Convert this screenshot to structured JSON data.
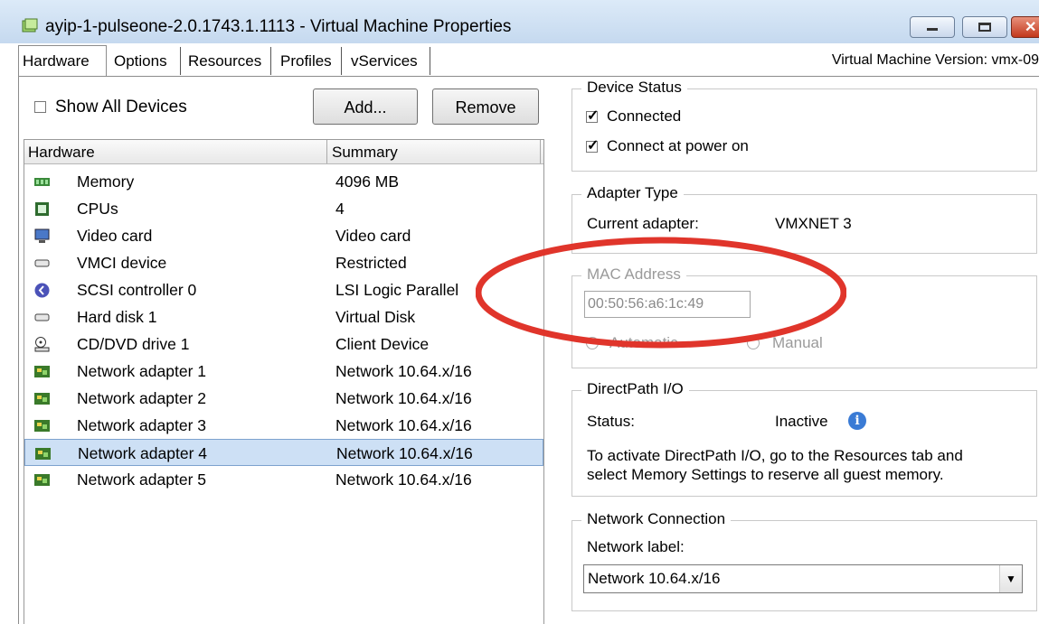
{
  "window": {
    "title": "ayip-1-pulseone-2.0.1743.1.1113 - Virtual Machine Properties",
    "controls": {
      "minimize": "▭",
      "maximize": "▭",
      "close": "✕"
    }
  },
  "tabs": [
    {
      "label": "Hardware",
      "active": true
    },
    {
      "label": "Options"
    },
    {
      "label": "Resources"
    },
    {
      "label": "Profiles"
    },
    {
      "label": "vServices"
    }
  ],
  "vm_version": "Virtual Machine Version: vmx-09",
  "left": {
    "show_all_label": "Show All Devices",
    "add_button": "Add...",
    "remove_button": "Remove",
    "columns": [
      "Hardware",
      "Summary"
    ],
    "rows": [
      {
        "name": "Memory",
        "summary": "4096 MB",
        "icon": "memory-icon"
      },
      {
        "name": "CPUs",
        "summary": "4",
        "icon": "cpu-icon"
      },
      {
        "name": "Video card",
        "summary": "Video card",
        "icon": "monitor-icon"
      },
      {
        "name": "VMCI device",
        "summary": "Restricted",
        "icon": "device-icon"
      },
      {
        "name": "SCSI controller 0",
        "summary": "LSI Logic Parallel",
        "icon": "scsi-icon"
      },
      {
        "name": "Hard disk 1",
        "summary": "Virtual Disk",
        "icon": "disk-icon"
      },
      {
        "name": "CD/DVD drive 1",
        "summary": "Client Device",
        "icon": "cd-icon"
      },
      {
        "name": "Network adapter 1",
        "summary": "Network 10.64.x/16",
        "icon": "network-icon"
      },
      {
        "name": "Network adapter 2",
        "summary": "Network 10.64.x/16",
        "icon": "network-icon"
      },
      {
        "name": "Network adapter 3",
        "summary": "Network 10.64.x/16",
        "icon": "network-icon"
      },
      {
        "name": "Network adapter 4",
        "summary": "Network 10.64.x/16",
        "icon": "network-icon",
        "selected": true
      },
      {
        "name": "Network adapter 5",
        "summary": "Network 10.64.x/16",
        "icon": "network-icon"
      }
    ]
  },
  "device_status": {
    "title": "Device Status",
    "connected": "Connected",
    "connect_at_power_on": "Connect at power on"
  },
  "adapter_type": {
    "title": "Adapter Type",
    "current_label": "Current adapter:",
    "current_value": "VMXNET 3"
  },
  "mac": {
    "title": "MAC Address",
    "value": "00:50:56:a6:1c:49",
    "automatic": "Automatic",
    "manual": "Manual"
  },
  "directpath": {
    "title": "DirectPath I/O",
    "status_label": "Status:",
    "status_value": "Inactive",
    "note_line1": "To activate DirectPath I/O, go to the Resources tab and",
    "note_line2": "select Memory Settings to reserve all guest memory."
  },
  "network_connection": {
    "title": "Network Connection",
    "label": "Network label:",
    "selected": "Network 10.64.x/16"
  },
  "colors": {
    "selection": "#cde0f5",
    "annotation": "#e0352b",
    "info": "#3a7bd5"
  }
}
